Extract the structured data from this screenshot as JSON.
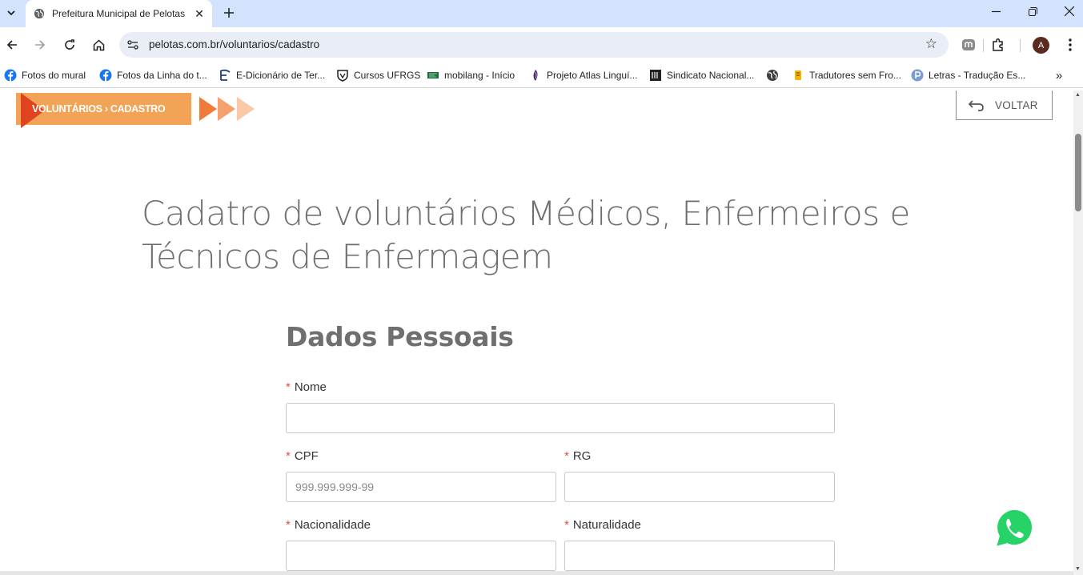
{
  "browser": {
    "tab": {
      "title": "Prefeitura Municipal de Pelotas"
    },
    "url": "pelotas.com.br/voluntarios/cadastro",
    "avatar_letter": "A",
    "bookmarks": [
      {
        "label": "Fotos do mural",
        "icon": "facebook-icon"
      },
      {
        "label": "Fotos da Linha do t...",
        "icon": "facebook-icon"
      },
      {
        "label": "E-Dicionário de Ter...",
        "icon": "edicionario-icon"
      },
      {
        "label": "Cursos UFRGS",
        "icon": "ufrgs-shield-icon"
      },
      {
        "label": "mobilang - Início",
        "icon": "mobilang-icon"
      },
      {
        "label": "Projeto Atlas Linguí...",
        "icon": "atlas-icon"
      },
      {
        "label": "Sindicato Nacional...",
        "icon": "sindicato-icon"
      },
      {
        "label": "",
        "icon": "globe-icon"
      },
      {
        "label": "Tradutores sem Fro...",
        "icon": "tradutores-icon"
      },
      {
        "label": "Letras - Tradução Es...",
        "icon": "letras-icon"
      }
    ]
  },
  "page": {
    "breadcrumb": "VOLUNTÁRIOS › CADASTRO",
    "back_button": "VOLTAR",
    "title": "Cadatro de voluntários Médicos, Enfermeiros e Técnicos de Enfermagem",
    "section": "Dados Pessoais",
    "required_marker": "*",
    "fields": {
      "nome": {
        "label": "Nome",
        "value": "",
        "placeholder": ""
      },
      "cpf": {
        "label": "CPF",
        "value": "",
        "placeholder": "999.999.999-99"
      },
      "rg": {
        "label": "RG",
        "value": "",
        "placeholder": ""
      },
      "nacionalidade": {
        "label": "Nacionalidade",
        "value": "",
        "placeholder": ""
      },
      "naturalidade": {
        "label": "Naturalidade",
        "value": "",
        "placeholder": ""
      }
    }
  },
  "colors": {
    "banner": "#f2a356",
    "banner_triangle": "#e0431f",
    "required": "#e74c3c",
    "whatsapp": "#25d366"
  }
}
